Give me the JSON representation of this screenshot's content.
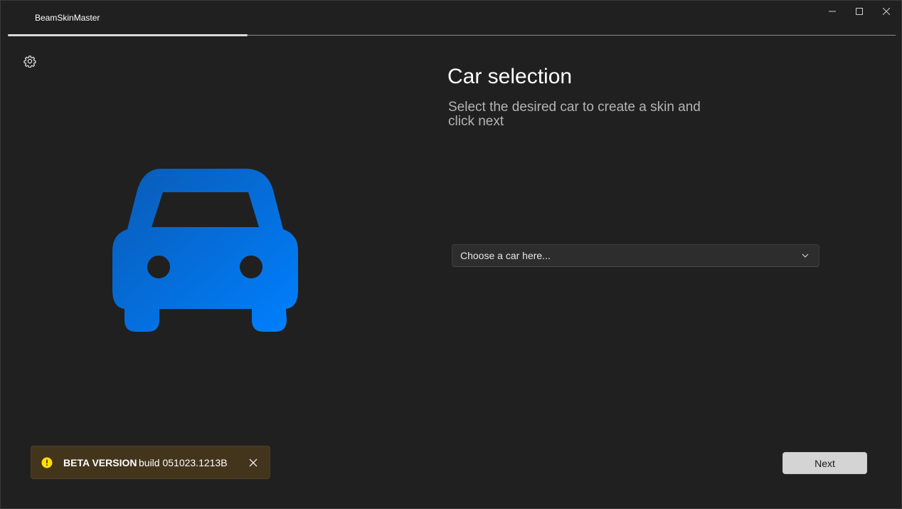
{
  "window": {
    "title": "BeamSkinMaster"
  },
  "wizard": {
    "progress_fraction": 0.27
  },
  "page": {
    "title": "Car selection",
    "subtitle": "Select the desired car to create a skin and click next"
  },
  "car_picker": {
    "placeholder": "Choose a car here..."
  },
  "beta_banner": {
    "title": "BETA VERSION",
    "build": "build 051023.1213B",
    "icon": "warning-icon"
  },
  "actions": {
    "next_label": "Next"
  },
  "colors": {
    "background": "#202020",
    "accent_car_top": "#0a5bb5",
    "accent_car_bottom": "#0080ff",
    "banner_background": "#43351c",
    "warning_yellow": "#fce100"
  },
  "icons": {
    "settings": "gear-icon",
    "illustration": "car-icon",
    "dropdown": "chevron-down-icon",
    "minimize": "minimize-icon",
    "maximize": "maximize-icon",
    "close": "close-icon"
  }
}
